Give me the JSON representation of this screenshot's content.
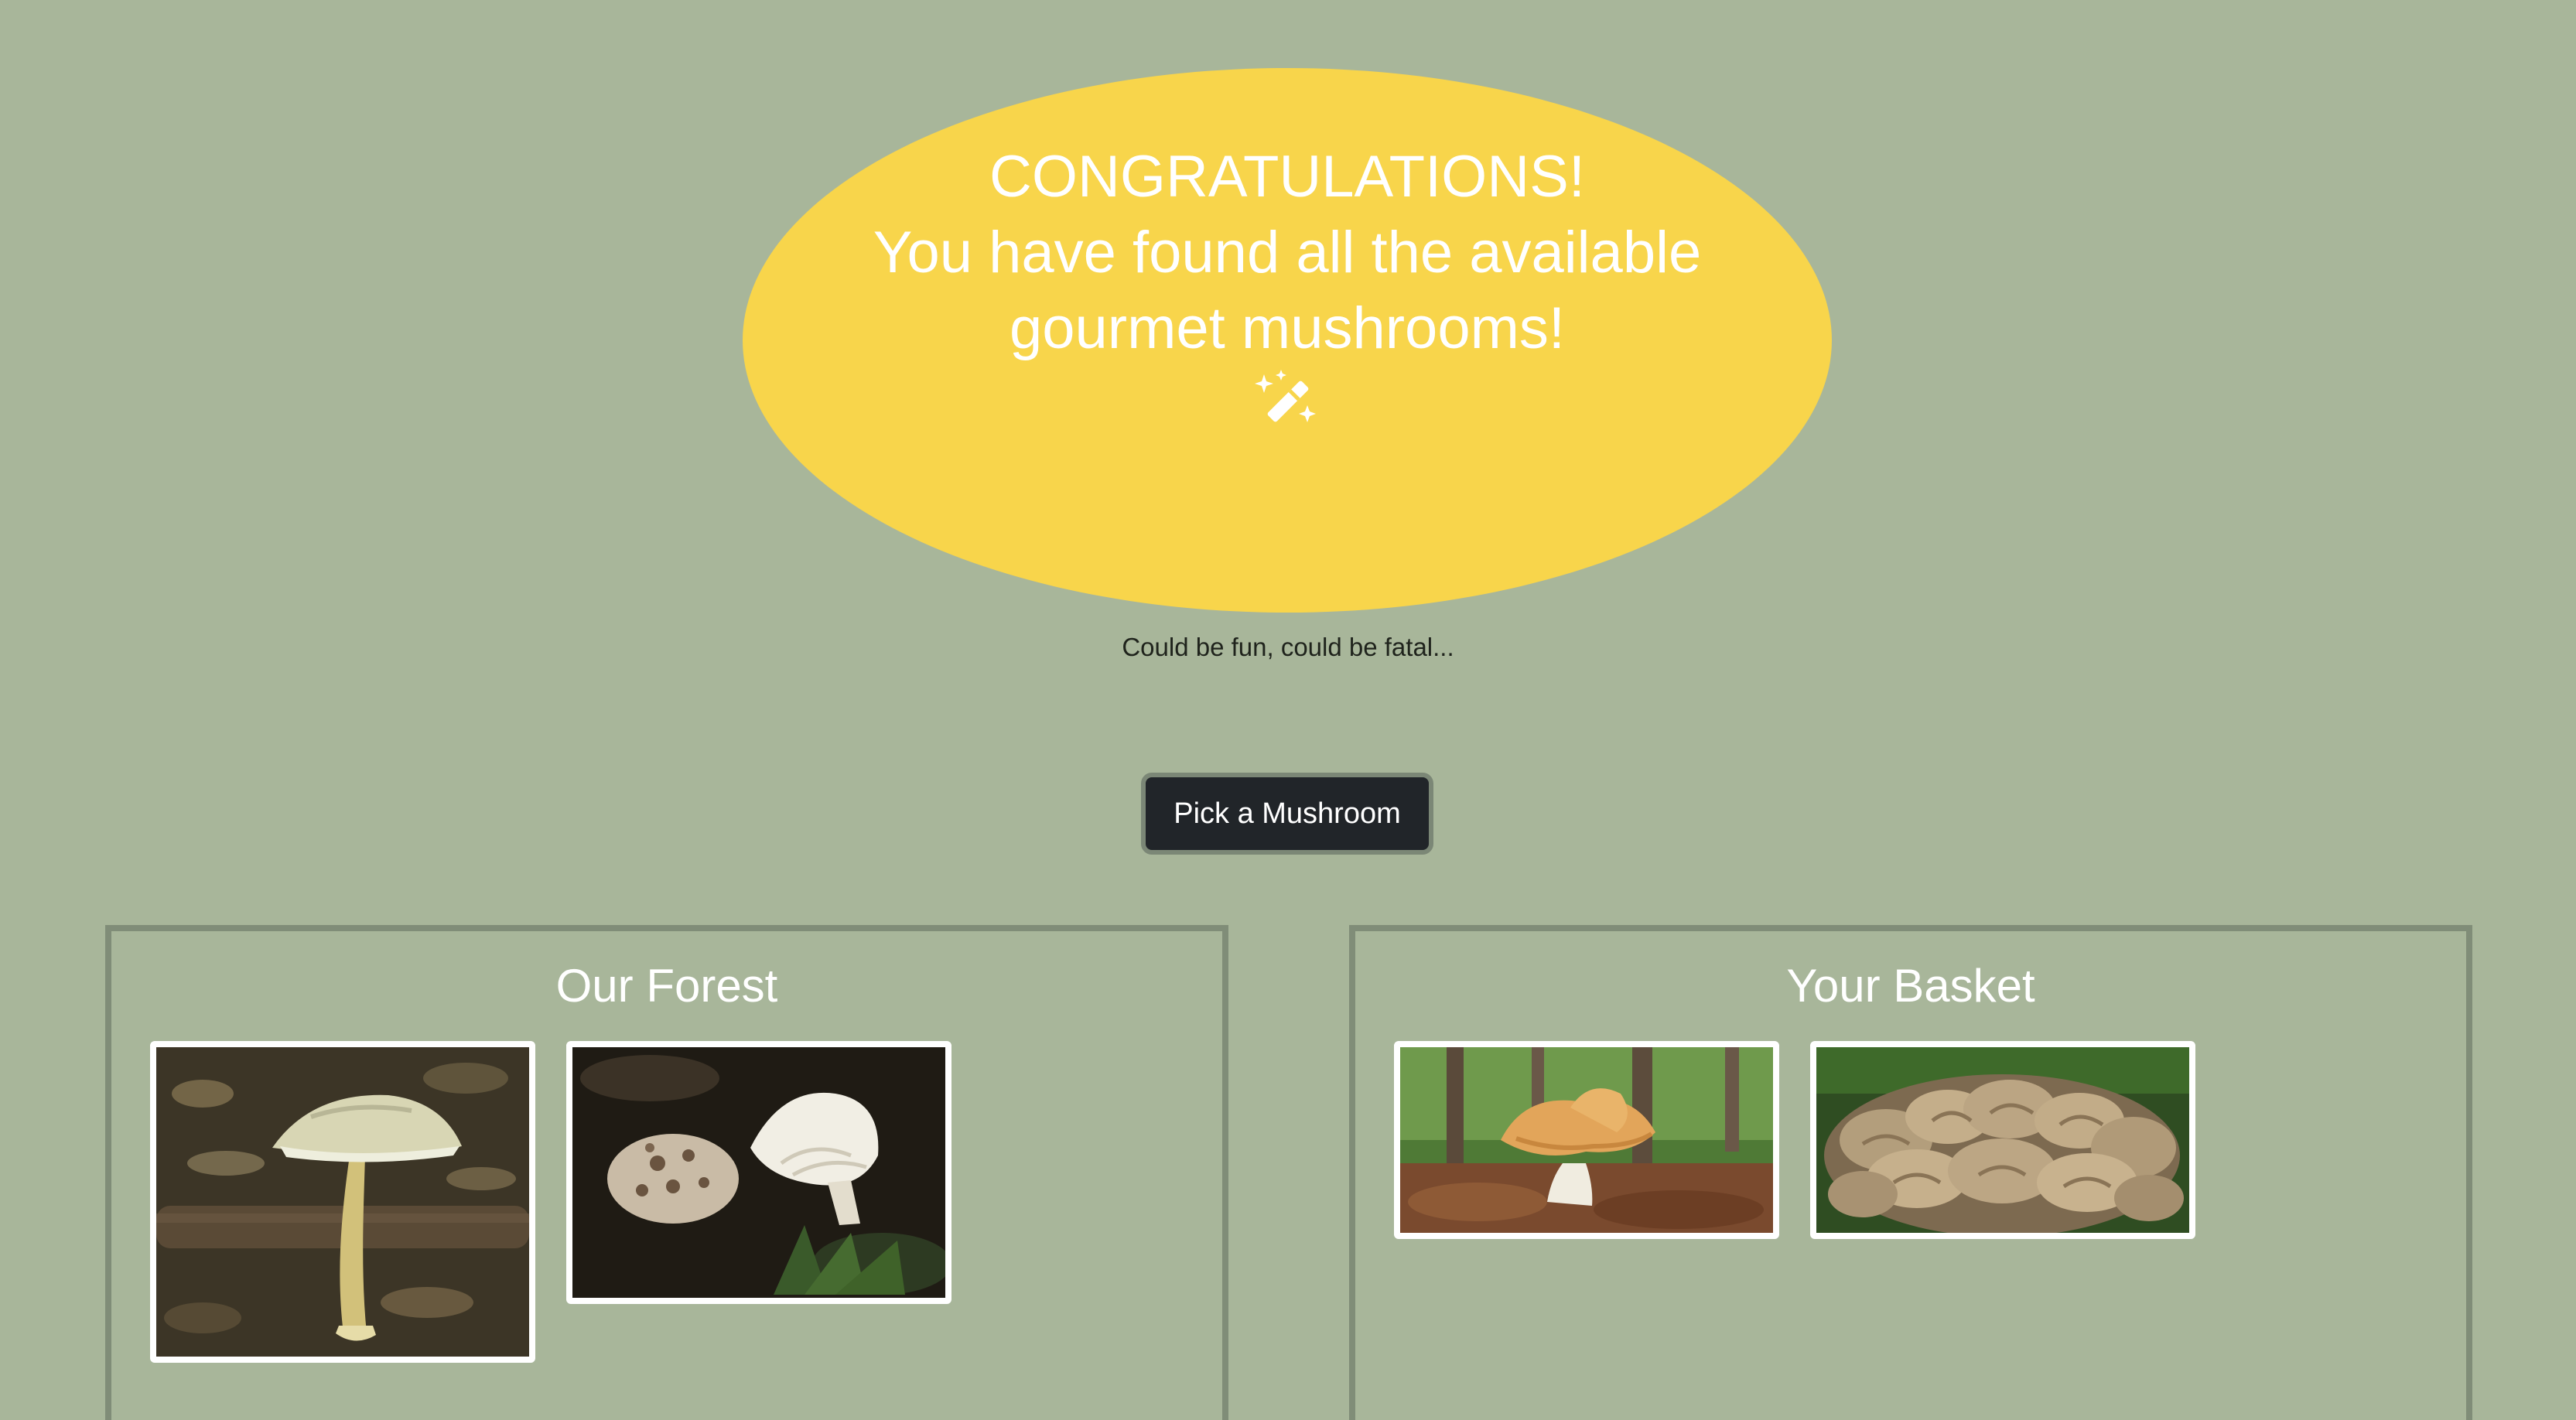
{
  "message": {
    "line1": "CONGRATULATIONS!",
    "line2": "You have found all the available",
    "line3": "gourmet mushrooms!",
    "icon": "magic-wand-icon"
  },
  "tagline": "Could be fun, could be fatal...",
  "pick_button": {
    "label": "Pick a Mushroom"
  },
  "forest": {
    "title": "Our Forest"
  },
  "basket": {
    "title": "Your Basket"
  },
  "colors": {
    "background": "#a8b69a",
    "bubble": "#f8d54b",
    "button": "#212529",
    "panel_border": "#808d78"
  }
}
